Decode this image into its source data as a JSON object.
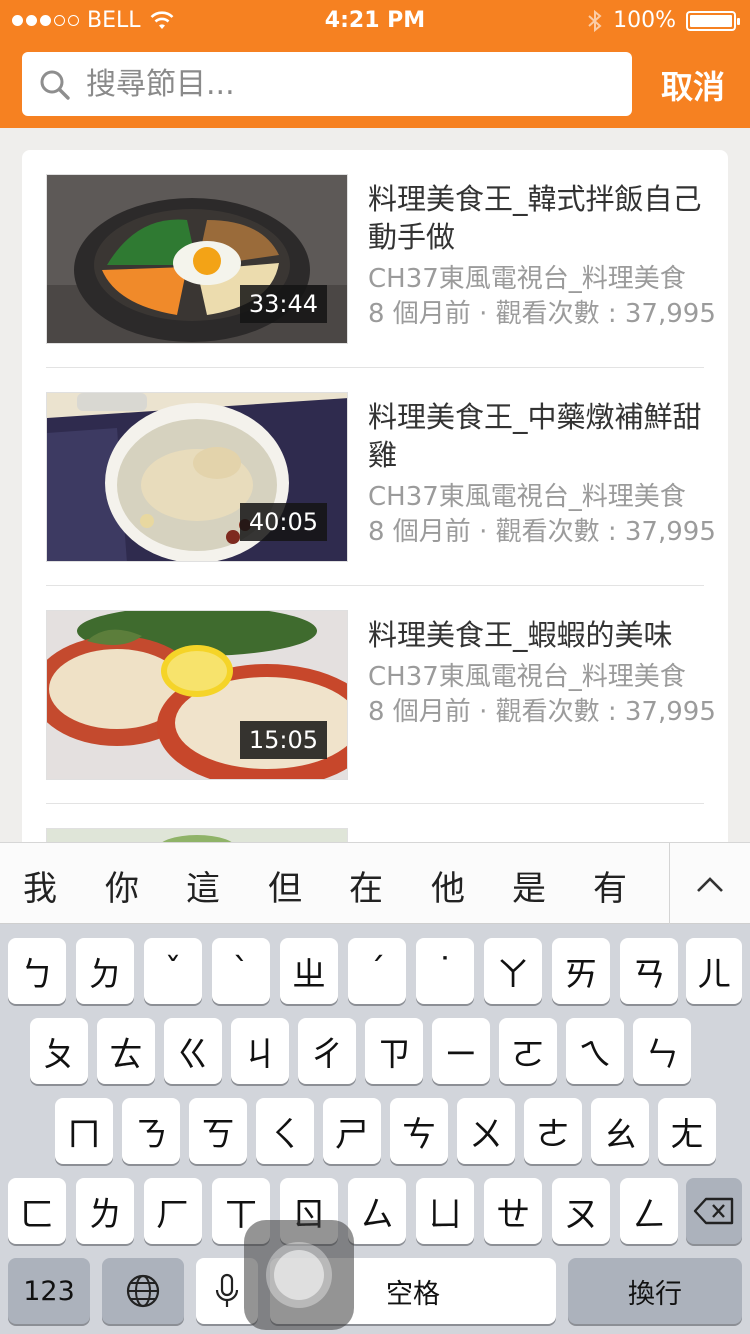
{
  "status_bar": {
    "carrier": "BELL",
    "time": "4:21 PM",
    "battery": "100%"
  },
  "search": {
    "placeholder": "搜尋節目...",
    "cancel_label": "取消"
  },
  "results": [
    {
      "title": "料理美食王_韓式拌飯自己動手做",
      "channel": "CH37東風電視台_料理美食",
      "meta": "8 個月前 · 觀看次數 : 37,995",
      "duration": "33:44"
    },
    {
      "title": "料理美食王_中藥燉補鮮甜雞",
      "channel": "CH37東風電視台_料理美食",
      "meta": "8 個月前 · 觀看次數 : 37,995",
      "duration": "40:05"
    },
    {
      "title": "料理美食王_蝦蝦的美味",
      "channel": "CH37東風電視台_料理美食",
      "meta": "8 個月前 · 觀看次數 : 37,995",
      "duration": "15:05"
    }
  ],
  "keyboard": {
    "candidates": [
      "我",
      "你",
      "這",
      "但",
      "在",
      "他",
      "是",
      "有"
    ],
    "row1": [
      "ㄅ",
      "ㄉ",
      "ˇ",
      "ˋ",
      "ㄓ",
      "ˊ",
      "˙",
      "ㄚ",
      "ㄞ",
      "ㄢ",
      "ㄦ"
    ],
    "row2": [
      "ㄆ",
      "ㄊ",
      "ㄍ",
      "ㄐ",
      "ㄔ",
      "ㄗ",
      "ㄧ",
      "ㄛ",
      "ㄟ",
      "ㄣ"
    ],
    "row3": [
      "ㄇ",
      "ㄋ",
      "ㄎ",
      "ㄑ",
      "ㄕ",
      "ㄘ",
      "ㄨ",
      "ㄜ",
      "ㄠ",
      "ㄤ"
    ],
    "row4": [
      "ㄈ",
      "ㄌ",
      "ㄏ",
      "ㄒ",
      "ㄖ",
      "ㄙ",
      "ㄩ",
      "ㄝ",
      "ㄡ",
      "ㄥ"
    ],
    "numbers_label": "123",
    "space_label": "空格",
    "return_label": "換行"
  },
  "colors": {
    "brand": "#f68121"
  }
}
